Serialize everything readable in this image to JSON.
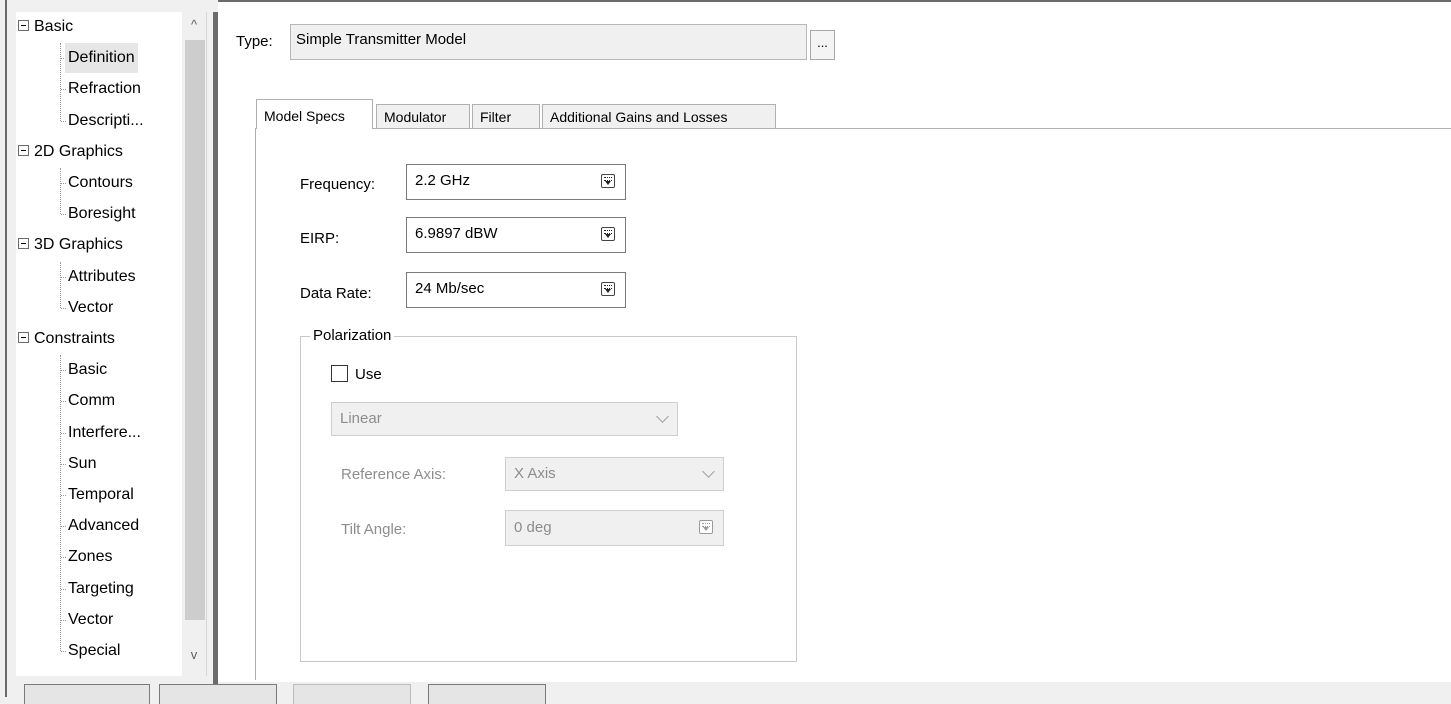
{
  "tree": {
    "items": [
      {
        "label": "Basic",
        "type": "group"
      },
      {
        "label": "Definition",
        "type": "child",
        "selected": true
      },
      {
        "label": "Refraction",
        "type": "child"
      },
      {
        "label": "Descripti...",
        "type": "child"
      },
      {
        "label": "2D Graphics",
        "type": "group"
      },
      {
        "label": "Contours",
        "type": "child"
      },
      {
        "label": "Boresight",
        "type": "child"
      },
      {
        "label": "3D Graphics",
        "type": "group"
      },
      {
        "label": "Attributes",
        "type": "child"
      },
      {
        "label": "Vector",
        "type": "child"
      },
      {
        "label": "Constraints",
        "type": "group"
      },
      {
        "label": "Basic",
        "type": "child"
      },
      {
        "label": "Comm",
        "type": "child"
      },
      {
        "label": "Interfere...",
        "type": "child"
      },
      {
        "label": "Sun",
        "type": "child"
      },
      {
        "label": "Temporal",
        "type": "child"
      },
      {
        "label": "Advanced",
        "type": "child"
      },
      {
        "label": "Zones",
        "type": "child"
      },
      {
        "label": "Targeting",
        "type": "child"
      },
      {
        "label": "Vector",
        "type": "child"
      },
      {
        "label": "Special",
        "type": "child"
      }
    ],
    "scroll_up_glyph": "^",
    "scroll_down_glyph": "v"
  },
  "type_field": {
    "label": "Type:",
    "value": "Simple Transmitter Model",
    "browse_label": "..."
  },
  "tabs": [
    {
      "label": "Model Specs",
      "active": true
    },
    {
      "label": "Modulator",
      "active": false
    },
    {
      "label": "Filter",
      "active": false
    },
    {
      "label": "Additional Gains and Losses",
      "active": false
    }
  ],
  "fields": {
    "frequency": {
      "label": "Frequency:",
      "value": "2.2 GHz",
      "icon": "units-picker-icon"
    },
    "eirp": {
      "label": "EIRP:",
      "value": "6.9897 dBW",
      "icon": "units-picker-icon"
    },
    "data_rate": {
      "label": "Data Rate:",
      "value": "24 Mb/sec",
      "icon": "units-picker-icon"
    }
  },
  "polarization": {
    "title": "Polarization",
    "use_label": "Use",
    "use_checked": false,
    "type_value": "Linear",
    "reference_axis_label": "Reference Axis:",
    "reference_axis_value": "X Axis",
    "tilt_angle_label": "Tilt Angle:",
    "tilt_angle_value": "0 deg"
  },
  "colors": {
    "selection_bg": "#e6e6e6",
    "frame_dark": "#6b6b6b",
    "disabled_text": "#8d8d8d"
  }
}
